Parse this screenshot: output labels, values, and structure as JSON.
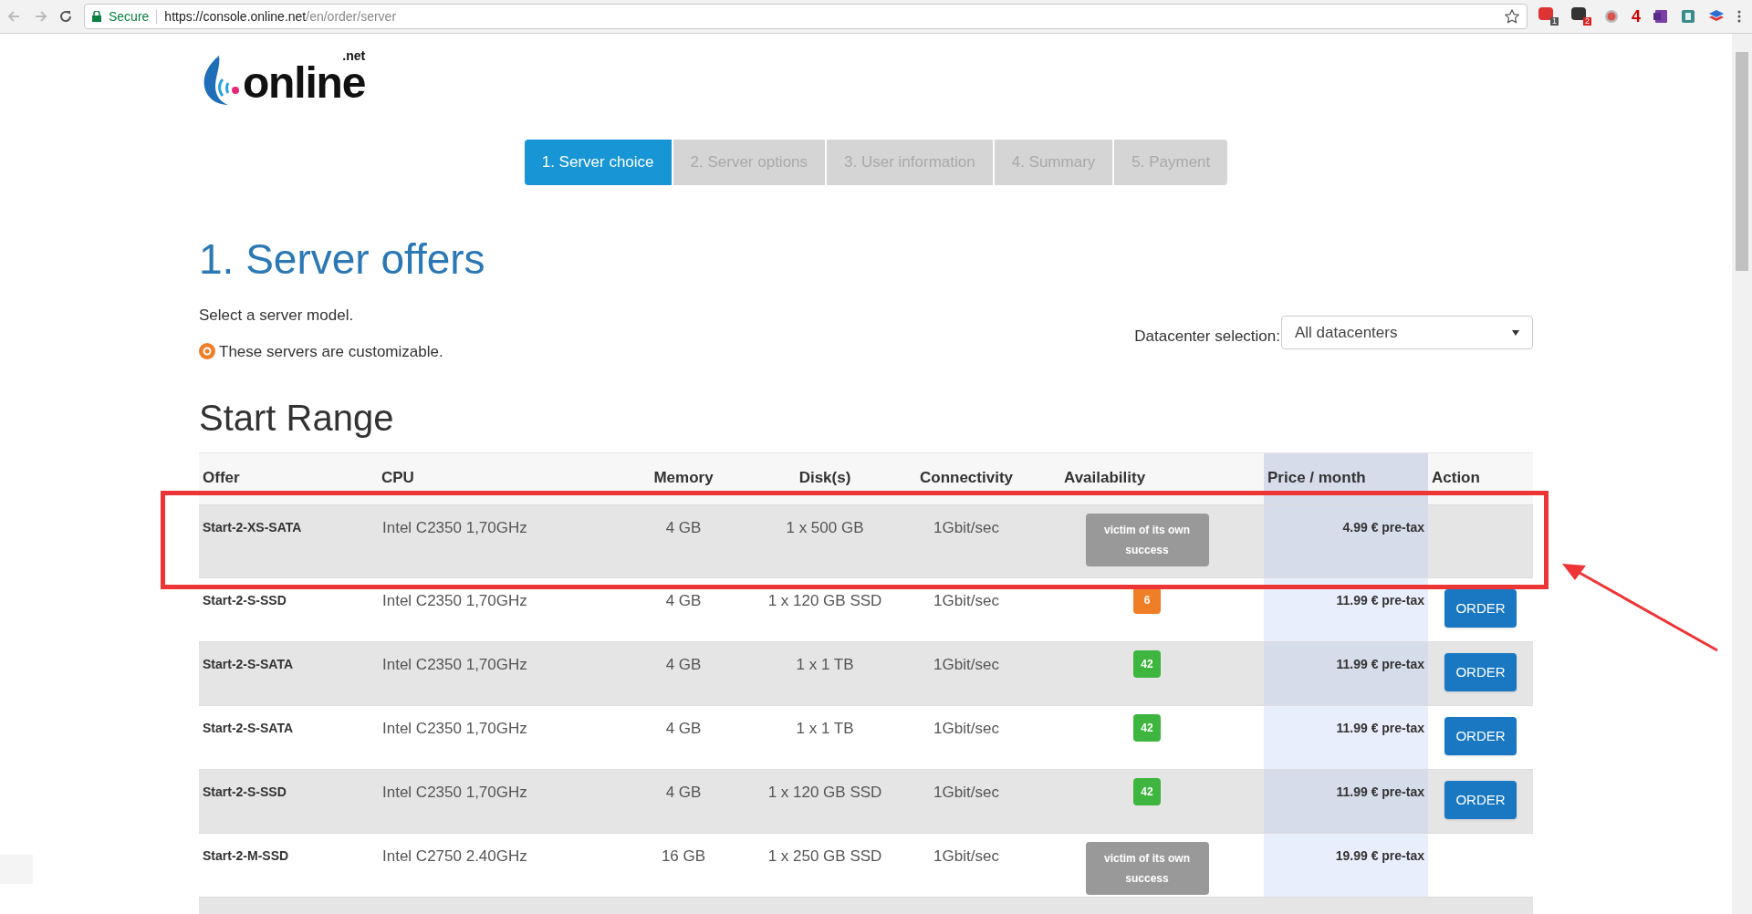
{
  "browser": {
    "secure_label": "Secure",
    "url_host": "https://console.online.net",
    "url_path": "/en/order/server",
    "extensions": [
      {
        "kind": "calendar",
        "badge": "1"
      },
      {
        "kind": "dark",
        "badge": "2"
      },
      {
        "kind": "dot"
      },
      {
        "kind": "letter",
        "text": "4"
      },
      {
        "kind": "notebook"
      },
      {
        "kind": "sheet"
      },
      {
        "kind": "stack"
      }
    ]
  },
  "logo": {
    "word": "online",
    "suffix": ".net"
  },
  "steps": [
    {
      "label": "1. Server choice",
      "selected": true
    },
    {
      "label": "2. Server options",
      "selected": false
    },
    {
      "label": "3. User information",
      "selected": false
    },
    {
      "label": "4. Summary",
      "selected": false
    },
    {
      "label": "5. Payment",
      "selected": false
    }
  ],
  "title": "1. Server offers",
  "intro": "Select a server model.",
  "customizable_note": "These servers are customizable.",
  "datacenter": {
    "label": "Datacenter selection:",
    "value": "All datacenters"
  },
  "range_title": "Start Range",
  "table": {
    "columns": [
      "Offer",
      "CPU",
      "Memory",
      "Disk(s)",
      "Connectivity",
      "Availability",
      "Price / month",
      "Action"
    ],
    "rows": [
      {
        "offer": "Start-2-XS-SATA",
        "cpu": "Intel C2350 1,70GHz",
        "memory": "4 GB",
        "disks": "1 x 500 GB",
        "connectivity": "1Gbit/sec",
        "availability": {
          "kind": "status",
          "text": "victim of its own success",
          "color": "#999999"
        },
        "price": "4.99 € pre-tax",
        "action": null,
        "highlighted": true
      },
      {
        "offer": "Start-2-S-SSD",
        "cpu": "Intel C2350 1,70GHz",
        "memory": "4 GB",
        "disks": "1 x 120 GB SSD",
        "connectivity": "1Gbit/sec",
        "availability": {
          "kind": "count",
          "text": "6",
          "color": "#f07e26"
        },
        "price": "11.99 € pre-tax",
        "action": "ORDER",
        "highlighted": false
      },
      {
        "offer": "Start-2-S-SATA",
        "cpu": "Intel C2350 1,70GHz",
        "memory": "4 GB",
        "disks": "1 x 1 TB",
        "connectivity": "1Gbit/sec",
        "availability": {
          "kind": "count",
          "text": "42",
          "color": "#3eb53e"
        },
        "price": "11.99 € pre-tax",
        "action": "ORDER",
        "highlighted": false
      },
      {
        "offer": "Start-2-S-SATA",
        "cpu": "Intel C2350 1,70GHz",
        "memory": "4 GB",
        "disks": "1 x 1 TB",
        "connectivity": "1Gbit/sec",
        "availability": {
          "kind": "count",
          "text": "42",
          "color": "#3eb53e"
        },
        "price": "11.99 € pre-tax",
        "action": "ORDER",
        "highlighted": false
      },
      {
        "offer": "Start-2-S-SSD",
        "cpu": "Intel C2350 1,70GHz",
        "memory": "4 GB",
        "disks": "1 x 120 GB SSD",
        "connectivity": "1Gbit/sec",
        "availability": {
          "kind": "count",
          "text": "42",
          "color": "#3eb53e"
        },
        "price": "11.99 € pre-tax",
        "action": "ORDER",
        "highlighted": false
      },
      {
        "offer": "Start-2-M-SSD",
        "cpu": "Intel C2750 2.40GHz",
        "memory": "16 GB",
        "disks": "1 x 250 GB SSD",
        "connectivity": "1Gbit/sec",
        "availability": {
          "kind": "status",
          "text": "victim of its own success",
          "color": "#999999"
        },
        "price": "19.99 € pre-tax",
        "action": null,
        "highlighted": false
      }
    ]
  }
}
